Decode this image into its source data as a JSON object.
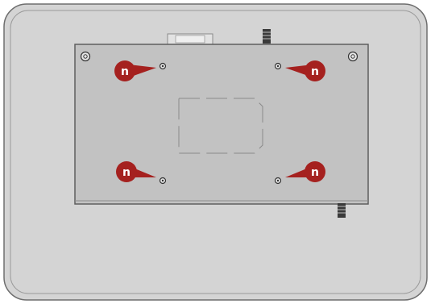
{
  "figure": {
    "subject": "monitor-rear-panel-vesa-mount",
    "colors": {
      "housing": "#d4d4d4",
      "housing_edge": "#6e6e6e",
      "plate": "#c2c2c2",
      "plate_edge": "#5e5e5e",
      "callout": "#a5211f",
      "callout_text": "#ffffff",
      "screw": "#e6e6e6"
    }
  },
  "callouts": [
    {
      "label": "n",
      "position": "top-left"
    },
    {
      "label": "n",
      "position": "top-right"
    },
    {
      "label": "n",
      "position": "bottom-left"
    },
    {
      "label": "n",
      "position": "bottom-right"
    }
  ]
}
